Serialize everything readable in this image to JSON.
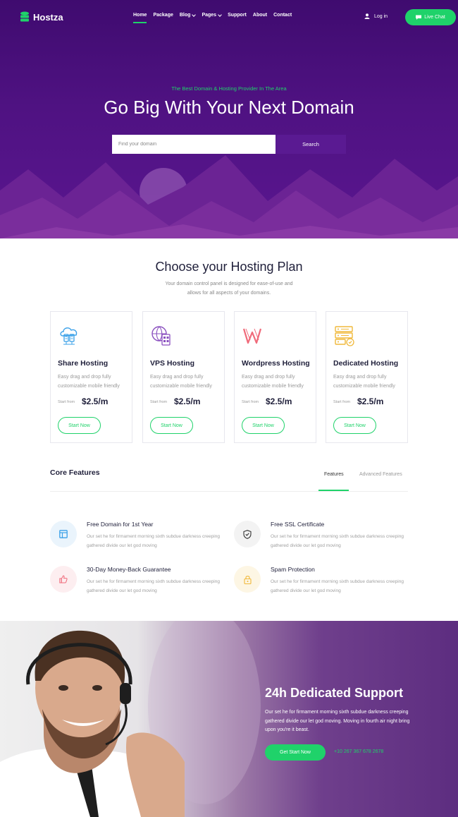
{
  "brand": {
    "name": "Hostza"
  },
  "nav": {
    "items": [
      {
        "label": "Home"
      },
      {
        "label": "Package"
      },
      {
        "label": "Blog"
      },
      {
        "label": "Pages"
      },
      {
        "label": "Support"
      },
      {
        "label": "About"
      },
      {
        "label": "Contact"
      }
    ],
    "login_label": "Log in",
    "livechat_label": "Live Chat"
  },
  "hero": {
    "subtitle": "The Best Domain & Hosting Provider In The Area",
    "title": "Go Big With Your Next Domain",
    "search_placeholder": "Find your domain",
    "search_button": "Search"
  },
  "plans": {
    "title": "Choose your Hosting Plan",
    "description": "Your domain control panel is designed for ease-of-use and allows for all aspects of your domains.",
    "cards": [
      {
        "title": "Share Hosting",
        "desc": "Easy drag and drop fully customizable mobile friendly",
        "from": "Start from",
        "price": "$2.5/m",
        "button": "Start Now",
        "icon": "cloud-server-icon"
      },
      {
        "title": "VPS Hosting",
        "desc": "Easy drag and drop fully customizable mobile friendly",
        "from": "Start from",
        "price": "$2.5/m",
        "button": "Start Now",
        "icon": "globe-server-icon"
      },
      {
        "title": "Wordpress Hosting",
        "desc": "Easy drag and drop fully customizable mobile friendly",
        "from": "Start from",
        "price": "$2.5/m",
        "button": "Start Now",
        "icon": "wordpress-icon"
      },
      {
        "title": "Dedicated Hosting",
        "desc": "Easy drag and drop fully customizable mobile friendly",
        "from": "Start from",
        "price": "$2.5/m",
        "button": "Start Now",
        "icon": "dedicated-server-icon"
      }
    ]
  },
  "features": {
    "title": "Core Features",
    "tabs": [
      {
        "label": "Features"
      },
      {
        "label": "Advanced Features"
      }
    ],
    "items": [
      {
        "title": "Free Domain for 1st Year",
        "desc": "Our set he for firmament morning sixth subdue darkness creeping gathered divide our let god moving",
        "icon": "browser-window-icon",
        "color": "#3aa0e8"
      },
      {
        "title": "Free SSL Certificate",
        "desc": "Our set he for firmament morning sixth subdue darkness creeping gathered divide our let god moving",
        "icon": "shield-check-icon",
        "color": "#333333"
      },
      {
        "title": "30-Day Money-Back Guarantee",
        "desc": "Our set he for firmament morning sixth subdue darkness creeping gathered divide our let god moving",
        "icon": "thumbs-up-icon",
        "color": "#f06a7a"
      },
      {
        "title": "Spam Protection",
        "desc": "Our set he for firmament morning sixth subdue darkness creeping gathered divide our let god moving",
        "icon": "lock-icon",
        "color": "#f0b83a"
      }
    ]
  },
  "support": {
    "title": "24h Dedicated Support",
    "desc": "Our set he for firmament morning sixth subdue darkness creeping gathered divide our let god moving. Moving in fourth air night bring upon you're it beast.",
    "button": "Get Start Now",
    "phone": "+10 267 367 678 2678"
  },
  "colors": {
    "accent": "#1fd26a",
    "hero": "#4a1280",
    "text_dark": "#1f1f3a"
  }
}
